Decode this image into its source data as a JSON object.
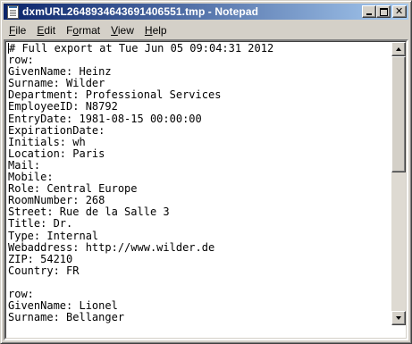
{
  "window": {
    "title": "dxmURL2648934643691406551.tmp - Notepad",
    "icon": "notepad-icon",
    "controls": {
      "minimize": "_",
      "maximize": "□",
      "close": "✕"
    }
  },
  "menubar": {
    "items": [
      {
        "label": "File",
        "accel": "F"
      },
      {
        "label": "Edit",
        "accel": "E"
      },
      {
        "label": "Format",
        "accel": "o"
      },
      {
        "label": "View",
        "accel": "V"
      },
      {
        "label": "Help",
        "accel": "H"
      }
    ]
  },
  "document": {
    "lines": [
      "# Full export at Tue Jun 05 09:04:31 2012",
      "row:",
      "GivenName: Heinz",
      "Surname: Wilder",
      "Department: Professional Services",
      "EmployeeID: N8792",
      "EntryDate: 1981-08-15 00:00:00",
      "ExpirationDate:",
      "Initials: wh",
      "Location: Paris",
      "Mail:",
      "Mobile:",
      "Role: Central Europe",
      "RoomNumber: 268",
      "Street: Rue de la Salle 3",
      "Title: Dr.",
      "Type: Internal",
      "Webaddress: http://www.wilder.de",
      "ZIP: 54210",
      "Country: FR",
      "",
      "row:",
      "GivenName: Lionel",
      "Surname: Bellanger"
    ]
  },
  "scrollbar": {
    "position": 0.0
  },
  "colors": {
    "titlebar_start": "#0a246a",
    "titlebar_end": "#a6caf0",
    "face": "#d4d0c8"
  }
}
